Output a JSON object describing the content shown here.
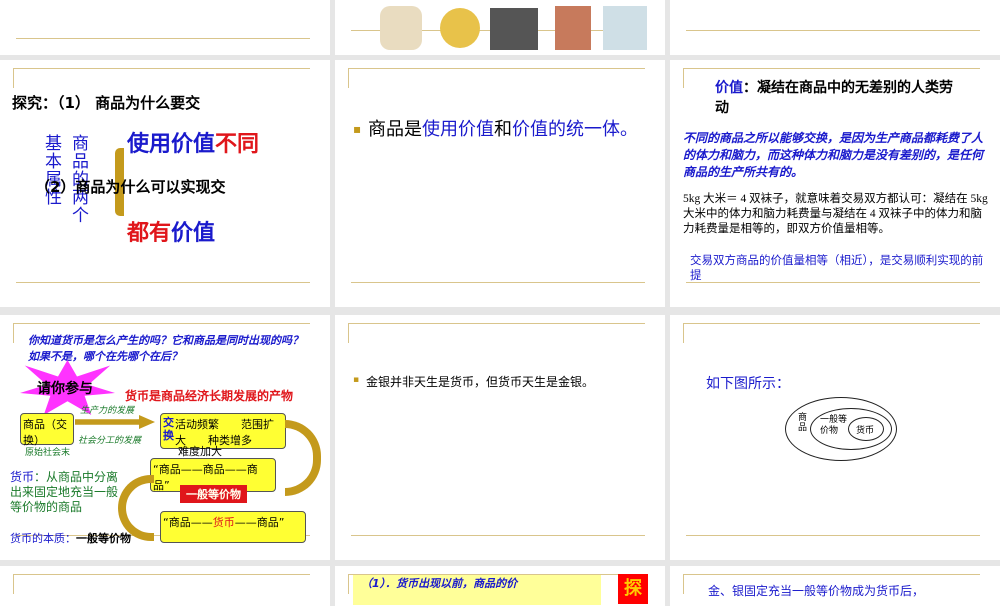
{
  "slides": [
    {
      "id": "top-middle",
      "images": [
        "rice-cooker",
        "teapot",
        "television",
        "food-packages",
        "juicer"
      ]
    },
    {
      "id": "s1",
      "title": "探究：（1） 商品为什么要交",
      "q2": "（2）商品为什么可以实现交",
      "vert1": "基本属性",
      "vert2": "商品的两个",
      "line1a": "使用价值",
      "line1b": "不同",
      "line2a": "都有",
      "line2b": "价值"
    },
    {
      "id": "s2",
      "bullet": "▪",
      "text_a": "商品是",
      "text_b": "使用价值",
      "text_c": "和",
      "text_d": "价值",
      "text_e": "的统一体。"
    },
    {
      "id": "s3",
      "label": "价值",
      "def": "：凝结在商品中的无差别的人类劳动",
      "para": "不同的商品之所以能够交换，是因为生产商品都耗费了人的体力和脑力，而这种体力和脑力是没有差别的，是任何商品的生产所共有的。",
      "example": "5kg 大米＝ 4 双袜子，就意味着交易双方都认可：凝结在 5kg 大米中的体力和脑力耗费量与凝结在 4 双袜子中的体力和脑力耗费量是相等的，即双方价值量相等。",
      "note": "交易双方商品的价值量相等（相近），是交易顺利实现的前提"
    },
    {
      "id": "s4",
      "question": "你知道货币是怎么产生的吗？它和商品是同时出现的吗？如果不是，哪个在先哪个在后？",
      "star": "请你参与",
      "origin": "货币是商品经济长期发展的产物",
      "box1": "商品（交换）",
      "b1note": "原始社会末",
      "arrow_top": "生产力的发展",
      "arrow_bottom": "社会分工的发展",
      "box2_head": "交换",
      "box2": "活动频繁　　范围扩大　　种类增多",
      "box2_extra": "难度加大",
      "box3": "“商品——商品——商品”",
      "equiv": "一般等价物",
      "money_def_a": "货币",
      "money_def_b": "：从商品中分离出来固定地充当一般等价物的商品",
      "box4a": "“商品——",
      "box4b": "货币",
      "box4c": "——商品”",
      "essence": "货币的本质：",
      "essence_val": "一般等价物"
    },
    {
      "id": "s5",
      "bullet": "▪",
      "text": "金银并非天生是货币，但货币天生是金银。"
    },
    {
      "id": "s6",
      "text": "如下图所示：",
      "outer": "商品",
      "middle": "一般等价物",
      "inner": "货币"
    },
    {
      "id": "s7",
      "text": "（1）．货币出现以前，商品的价",
      "badge": "探"
    },
    {
      "id": "s8",
      "text": "金、银固定充当一般等价物成为货币后，"
    }
  ],
  "colors": {
    "gold": "#d9c58c",
    "blue": "#1a1acc",
    "red": "#e0161b",
    "bg": "#e6e6e6"
  }
}
